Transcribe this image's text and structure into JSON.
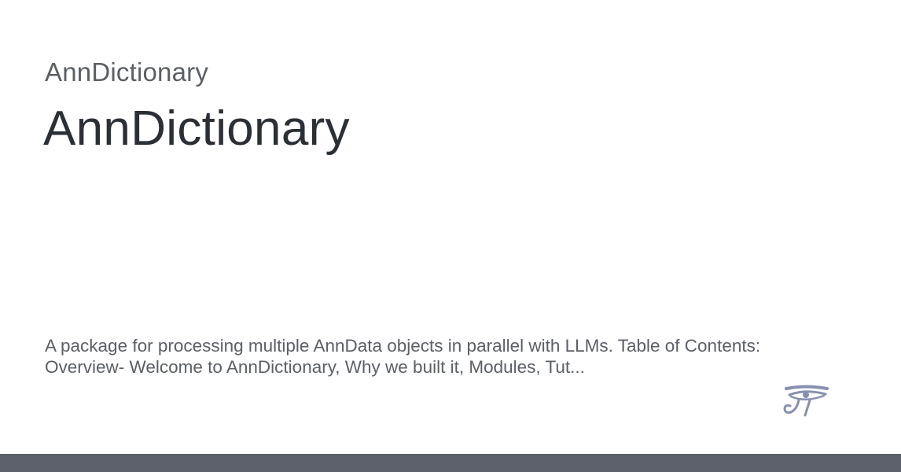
{
  "preview": {
    "site_name": "AnnDictionary",
    "title": "AnnDictionary",
    "description": "A package for processing multiple AnnData objects in parallel with LLMs. Table of Contents: Overview- Welcome to AnnDictionary, Why we built it, Modules, Tut...",
    "logo_icon": "eye-of-horus-icon",
    "colors": {
      "footer_bar": "#5c616b",
      "logo": "#8890b0",
      "title_text": "#2b2f36",
      "secondary_text": "#5b5f66"
    }
  }
}
